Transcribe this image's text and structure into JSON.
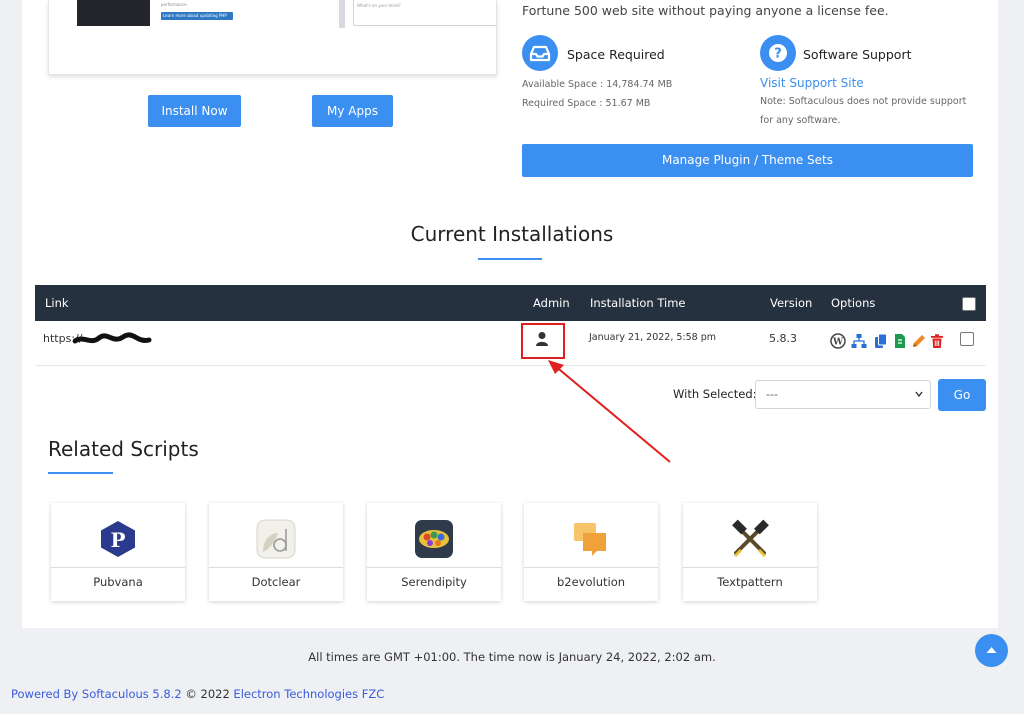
{
  "preview": {
    "tiny_text": "performance.",
    "blue_text": "Learn more about updating PHP",
    "box_text": "What's on your mind?"
  },
  "buttons": {
    "install_now": "Install Now",
    "my_apps": "My Apps",
    "manage_sets": "Manage Plugin / Theme Sets",
    "go": "Go"
  },
  "intro_text": "Fortune 500 web site without paying anyone a license fee.",
  "space": {
    "title": "Space Required",
    "available": "Available Space : 14,784.74 MB",
    "required": "Required Space : 51.67 MB"
  },
  "support": {
    "title": "Software Support",
    "link": "Visit Support Site",
    "note_line1": "Note: Softaculous does not provide support",
    "note_line2": "for any software."
  },
  "installations": {
    "title": "Current Installations",
    "headers": {
      "link": "Link",
      "admin": "Admin",
      "time": "Installation Time",
      "version": "Version",
      "options": "Options"
    },
    "row": {
      "link": "https://",
      "time": "January 21, 2022, 5:58 pm",
      "version": "5.8.3"
    },
    "with_selected_label": "With Selected:",
    "with_selected_value": "---"
  },
  "related": {
    "title": "Related Scripts",
    "scripts": [
      "Pubvana",
      "Dotclear",
      "Serendipity",
      "b2evolution",
      "Textpattern"
    ]
  },
  "footer": {
    "times_note": "All times are GMT +01:00. The time now is January 24, 2022, 2:02 am.",
    "powered_prefix": "Powered By ",
    "powered_link": "Softaculous 5.8.2",
    "copyright": " © 2022 ",
    "company_link": "Electron Technologies FZC"
  },
  "colors": {
    "accent": "#3b8ff0",
    "table_header": "#26313f",
    "annotation": "#e02020"
  }
}
